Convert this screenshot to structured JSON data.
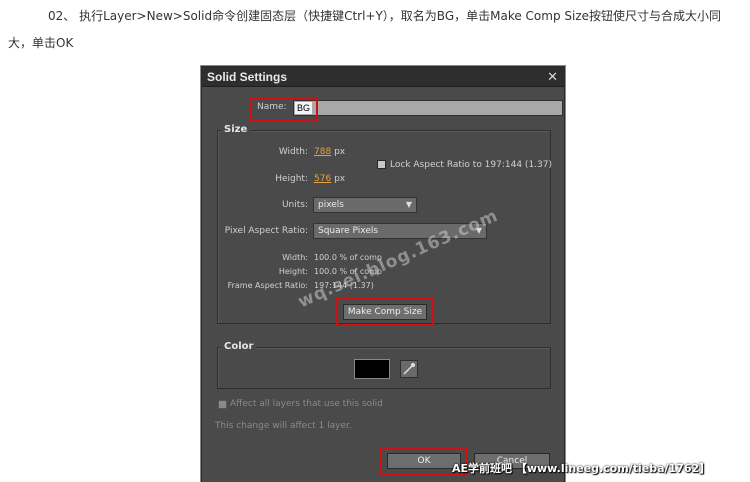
{
  "article": {
    "line1": "02、 执行Layer>New>Solid命令创建固态层（快捷键Ctrl+Y），取名为BG，单击Make Comp Size按钮使尺寸与合成大小同",
    "line2": "大，单击OK"
  },
  "dialog": {
    "title": "Solid Settings",
    "close_glyph": "✕",
    "name_label": "Name:",
    "name_value": "BG",
    "size_group": "Size",
    "width_label": "Width:",
    "width_value": "788",
    "height_label": "Height:",
    "height_value": "576",
    "unit_px": "px",
    "lock_aspect_label": "Lock Aspect Ratio to 197:144 (1.37)",
    "units_label": "Units:",
    "units_value": "pixels",
    "par_label": "Pixel Aspect Ratio:",
    "par_value": "Square Pixels",
    "width_pct_label": "Width:",
    "width_pct_value": "100.0 % of comp",
    "height_pct_label": "Height:",
    "height_pct_value": "100.0 % of comp",
    "frame_ar_label": "Frame Aspect Ratio:",
    "frame_ar_value": "197:144 (1.37)",
    "make_comp_size": "Make Comp Size",
    "color_group": "Color",
    "color_value": "#000000",
    "affect_all_label": "Affect all layers that use this solid",
    "affect_note": "This change will affect 1 layer.",
    "ok_label": "OK",
    "cancel_label": "Cancel"
  },
  "watermark_text": "wq.sei.blog.163.com",
  "footer_text": "AE学前班吧  【www.lineeg.com/tieba/1762】",
  "colors": {
    "dialog_bg": "#4a4a4a",
    "titlebar_bg": "#2e2e2e",
    "highlight_red": "#d01010",
    "value_orange": "#e6a23c"
  }
}
